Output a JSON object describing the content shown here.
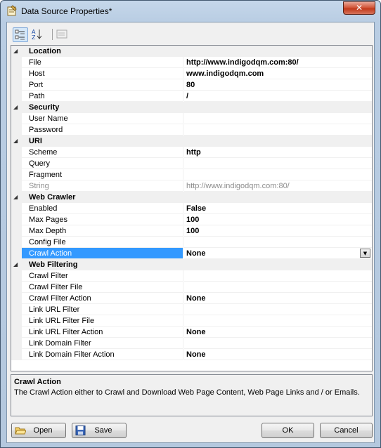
{
  "window": {
    "title": "Data Source Properties*",
    "close_label": "✕"
  },
  "toolbar": {
    "categorized_icon": "categorized-icon",
    "alphabetical_icon": "sort-az-icon",
    "property_pages_icon": "property-pages-icon"
  },
  "grid": {
    "rows": [
      {
        "type": "cat",
        "expander": "◢",
        "label": "Location"
      },
      {
        "type": "prop",
        "name": "File",
        "value": "http://www.indigodqm.com:80/"
      },
      {
        "type": "prop",
        "name": "Host",
        "value": "www.indigodqm.com"
      },
      {
        "type": "prop",
        "name": "Port",
        "value": "80"
      },
      {
        "type": "prop",
        "name": "Path",
        "value": "/"
      },
      {
        "type": "cat",
        "expander": "◢",
        "label": "Security"
      },
      {
        "type": "prop",
        "name": "User Name",
        "value": ""
      },
      {
        "type": "prop",
        "name": "Password",
        "value": ""
      },
      {
        "type": "cat",
        "expander": "◢",
        "label": "URI"
      },
      {
        "type": "prop",
        "name": "Scheme",
        "value": "http"
      },
      {
        "type": "prop",
        "name": "Query",
        "value": ""
      },
      {
        "type": "prop",
        "name": "Fragment",
        "value": ""
      },
      {
        "type": "prop",
        "name": "String",
        "value": "http://www.indigodqm.com:80/",
        "disabled": true
      },
      {
        "type": "cat",
        "expander": "◢",
        "label": "Web Crawler"
      },
      {
        "type": "prop",
        "name": "Enabled",
        "value": "False"
      },
      {
        "type": "prop",
        "name": "Max Pages",
        "value": "100"
      },
      {
        "type": "prop",
        "name": "Max Depth",
        "value": "100"
      },
      {
        "type": "prop",
        "name": "Config File",
        "value": ""
      },
      {
        "type": "prop",
        "name": "Crawl Action",
        "value": "None",
        "selected": true,
        "dropdown": "▼"
      },
      {
        "type": "cat",
        "expander": "◢",
        "label": "Web Filtering"
      },
      {
        "type": "prop",
        "name": "Crawl Filter",
        "value": ""
      },
      {
        "type": "prop",
        "name": "Crawl Filter File",
        "value": ""
      },
      {
        "type": "prop",
        "name": "Crawl Filter Action",
        "value": "None"
      },
      {
        "type": "prop",
        "name": "Link URL Filter",
        "value": ""
      },
      {
        "type": "prop",
        "name": "Link URL Filter File",
        "value": ""
      },
      {
        "type": "prop",
        "name": "Link URL Filter Action",
        "value": "None"
      },
      {
        "type": "prop",
        "name": "Link Domain Filter",
        "value": ""
      },
      {
        "type": "prop",
        "name": "Link Domain Filter Action",
        "value": "None"
      }
    ]
  },
  "help": {
    "title": "Crawl Action",
    "description": "The Crawl Action either to Crawl and Download Web Page Content, Web Page Links and / or Emails."
  },
  "buttons": {
    "open": "Open",
    "save": "Save",
    "ok": "OK",
    "cancel": "Cancel"
  },
  "colors": {
    "selection": "#3399ff",
    "title_gradient": "#c5d7ea",
    "close_red": "#c23a1b"
  }
}
